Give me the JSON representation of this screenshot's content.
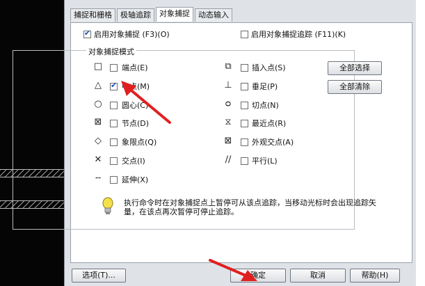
{
  "tabs": [
    "捕捉和栅格",
    "极轴追踪",
    "对象捕捉",
    "动态输入"
  ],
  "enable_osnap": {
    "label": "启用对象捕捉 (F3)(O)",
    "checked": true
  },
  "enable_tracking": {
    "label": "启用对象捕捉追踪 (F11)(K)",
    "checked": false
  },
  "group_title": "对象捕捉模式",
  "modes_left": [
    {
      "icon": "square-icon",
      "label": "端点(E)",
      "checked": false
    },
    {
      "icon": "triangle-icon",
      "label": "中点(M)",
      "checked": true
    },
    {
      "icon": "circle-icon",
      "label": "圆心(C)",
      "checked": false
    },
    {
      "icon": "node-icon",
      "label": "节点(D)",
      "checked": false
    },
    {
      "icon": "diamond-icon",
      "label": "象限点(Q)",
      "checked": false
    },
    {
      "icon": "cross-icon",
      "label": "交点(I)",
      "checked": false
    },
    {
      "icon": "extension-icon",
      "label": "延伸(X)",
      "checked": false
    }
  ],
  "modes_right": [
    {
      "icon": "insert-icon",
      "label": "插入点(S)",
      "checked": false
    },
    {
      "icon": "perpendicular-icon",
      "label": "垂足(P)",
      "checked": false
    },
    {
      "icon": "tangent-icon",
      "label": "切点(N)",
      "checked": false
    },
    {
      "icon": "nearest-icon",
      "label": "最近点(R)",
      "checked": false
    },
    {
      "icon": "apparent-intersection-icon",
      "label": "外观交点(A)",
      "checked": false
    },
    {
      "icon": "parallel-icon",
      "label": "平行(L)",
      "checked": false
    }
  ],
  "buttons": {
    "select_all": "全部选择",
    "clear_all": "全部清除"
  },
  "hint": "执行命令时在对象捕捉点上暂停可从该点追踪，当移动光标时会出现追踪矢量，在该点再次暂停可停止追踪。",
  "footer": {
    "options": "选项(T)...",
    "ok": "确定",
    "cancel": "取消",
    "help": "帮助(H)"
  },
  "colors": {
    "arrow": "#e02020",
    "check": "#1a4fbf"
  }
}
